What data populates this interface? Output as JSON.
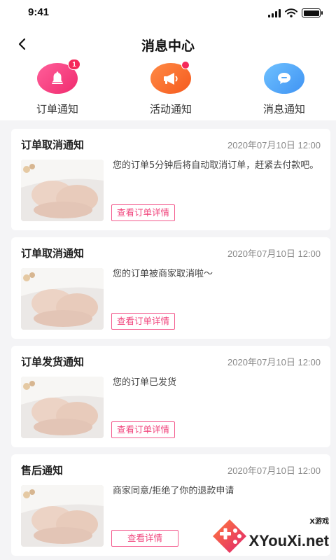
{
  "status_bar": {
    "time": "9:41"
  },
  "nav": {
    "title": "消息中心"
  },
  "categories": [
    {
      "label": "订单通知",
      "icon": "bell-icon",
      "color": "#f7367a",
      "badge": "1"
    },
    {
      "label": "活动通知",
      "icon": "megaphone-icon",
      "color": "#f86a2c",
      "badge_dot": true
    },
    {
      "label": "消息通知",
      "icon": "chat-bubble-icon",
      "color": "#4aa2f7"
    }
  ],
  "messages": [
    {
      "title": "订单取消通知",
      "time": "2020年07月10日 12:00",
      "text": "您的订单5分钟后将自动取消订单，赶紧去付款吧。",
      "button": "查看订单详情"
    },
    {
      "title": "订单取消通知",
      "time": "2020年07月10日 12:00",
      "text": "您的订单被商家取消啦～",
      "button": "查看订单详情"
    },
    {
      "title": "订单发货通知",
      "time": "2020年07月10日 12:00",
      "text": "您的订单已发货",
      "button": "查看订单详情"
    },
    {
      "title": "售后通知",
      "time": "2020年07月10日 12:00",
      "text": "商家同意/拒绝了你的退款申请",
      "button": "查看详情"
    }
  ],
  "watermark": {
    "small": "X游戏",
    "big": "XYouXi.net"
  },
  "colors": {
    "accent": "#f0447c",
    "background": "#f4f4f6"
  }
}
